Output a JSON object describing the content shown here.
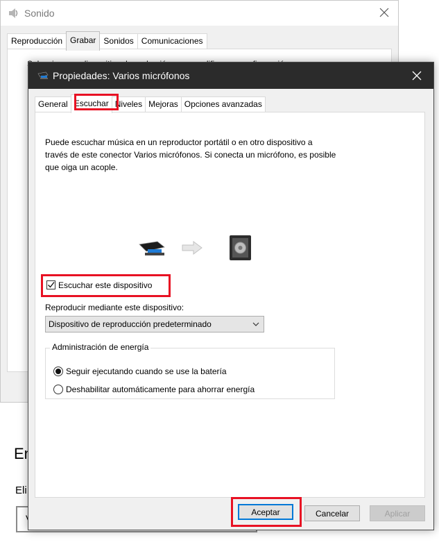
{
  "background_window": {
    "title": "Sonido",
    "tabs": [
      "Reproducción",
      "Grabar",
      "Sonidos",
      "Comunicaciones"
    ],
    "active_tab_index": 1,
    "panel_text": "Seleccione un dispositivo de grabación para modificar su configuración:",
    "heading_partial": "En",
    "subtext_partial": "Eli",
    "box_text_partial": "V"
  },
  "dialog": {
    "title": "Propiedades: Varios micrófonos",
    "tabs": {
      "general": "General",
      "escuchar": "Escuchar",
      "niveles": "Niveles",
      "mejoras": "Mejoras",
      "avanzadas": "Opciones avanzadas"
    },
    "active_tab": "Escuchar",
    "description": "Puede escuchar música en un reproductor portátil o en otro dispositivo a través de este conector Varios micrófonos. Si conecta un micrófono, es posible que oiga un acople.",
    "listen_checkbox": {
      "label": "Escuchar este dispositivo",
      "checked": true
    },
    "playback_label": "Reproducir mediante este dispositivo:",
    "playback_select": {
      "value": "Dispositivo de reproducción predeterminado"
    },
    "power_group": {
      "title": "Administración de energía",
      "options": [
        {
          "label": "Seguir ejecutando cuando se use la batería",
          "selected": true
        },
        {
          "label": "Deshabilitar automáticamente para ahorrar energía",
          "selected": false
        }
      ]
    },
    "buttons": {
      "ok": "Aceptar",
      "cancel": "Cancelar",
      "apply": "Aplicar"
    }
  },
  "colors": {
    "highlight": "#e81123",
    "titlebar": "#2b2b2b",
    "focus": "#0078d7"
  }
}
